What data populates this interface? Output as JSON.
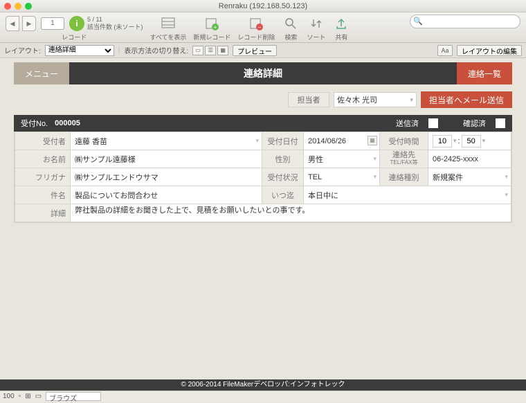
{
  "window": {
    "title": "Renraku (192.168.50.123)"
  },
  "toolbar": {
    "record_num": "1",
    "record_count": "5 / 11",
    "record_status": "該当件数 (未ソート)",
    "record_label": "レコード",
    "show_all": "すべてを表示",
    "new_record": "新規レコード",
    "delete_record": "レコード削除",
    "search": "検索",
    "sort": "ソート",
    "share": "共有",
    "search_placeholder": ""
  },
  "formatbar": {
    "layout_label": "レイアウト:",
    "layout_value": "連絡詳細",
    "view_label": "表示方法の切り替え:",
    "preview": "プレビュー",
    "aa": "Aa",
    "edit_layout": "レイアウトの編集"
  },
  "header": {
    "menu": "メニュー",
    "title": "連絡詳細",
    "list": "連絡一覧"
  },
  "assignee": {
    "label": "担当者",
    "value": "佐々木 光司",
    "send": "担当者へメール送信"
  },
  "receipt": {
    "no_label": "受付No.",
    "no": "000005",
    "sent_label": "送信済",
    "confirmed_label": "確認済"
  },
  "form": {
    "receiver_label": "受付者",
    "receiver": "遠藤 香苗",
    "date_label": "受付日付",
    "date": "2014/06/26",
    "time_label": "受付時間",
    "time_h": "10",
    "time_m": "50",
    "name_label": "お名前",
    "name": "㈱サンプル遠藤様",
    "gender_label": "性別",
    "gender": "男性",
    "contact_label": "連絡先",
    "contact_sub": "TEL/FAX等",
    "contact": "06-2425-xxxx",
    "furigana_label": "フリガナ",
    "furigana": "㈱サンプルエンドウサマ",
    "status_label": "受付状況",
    "status": "TEL",
    "type_label": "連絡種別",
    "type": "新規案件",
    "subject_label": "件名",
    "subject": "製品についてお問合わせ",
    "when_label": "いつ迄",
    "when": "本日中に",
    "detail_label": "詳細",
    "detail": "弊社製品の詳細をお聞きした上で、見積をお願いしたいとの事です。"
  },
  "footer": {
    "copyright": "© 2006-2014 FileMakerデベロッパ:インフォトレック"
  },
  "status": {
    "zoom": "100",
    "mode": "ブラウズ"
  }
}
